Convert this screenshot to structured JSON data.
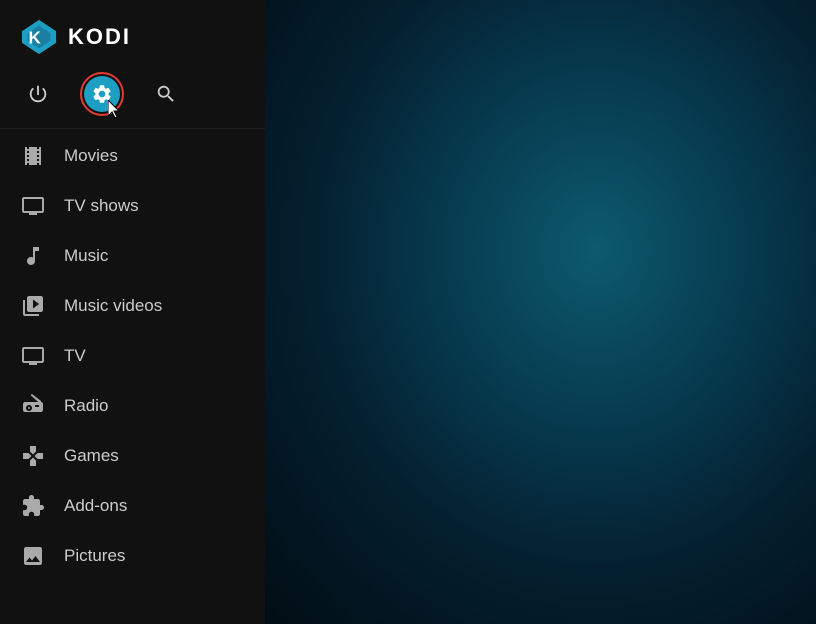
{
  "app": {
    "title": "KODI"
  },
  "top_icons": [
    {
      "id": "power",
      "label": "Power",
      "active": false
    },
    {
      "id": "settings",
      "label": "Settings",
      "active": true
    },
    {
      "id": "search",
      "label": "Search",
      "active": false
    }
  ],
  "nav_items": [
    {
      "id": "movies",
      "label": "Movies",
      "icon": "movies"
    },
    {
      "id": "tv-shows",
      "label": "TV shows",
      "icon": "tv-shows"
    },
    {
      "id": "music",
      "label": "Music",
      "icon": "music"
    },
    {
      "id": "music-videos",
      "label": "Music videos",
      "icon": "music-videos"
    },
    {
      "id": "tv",
      "label": "TV",
      "icon": "tv"
    },
    {
      "id": "radio",
      "label": "Radio",
      "icon": "radio"
    },
    {
      "id": "games",
      "label": "Games",
      "icon": "games"
    },
    {
      "id": "add-ons",
      "label": "Add-ons",
      "icon": "add-ons"
    },
    {
      "id": "pictures",
      "label": "Pictures",
      "icon": "pictures"
    }
  ],
  "colors": {
    "settings_active_bg": "#1d9fc4",
    "settings_active_border": "#e53935"
  }
}
